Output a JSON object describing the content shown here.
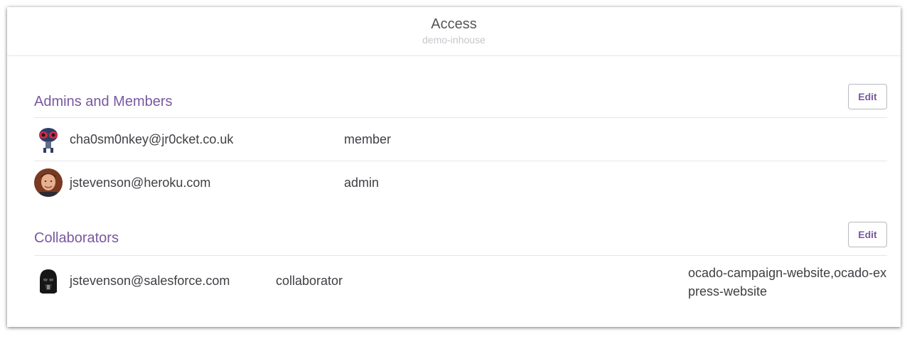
{
  "header": {
    "title": "Access",
    "subtitle": "demo-inhouse"
  },
  "admins_section": {
    "title": "Admins and Members",
    "edit_label": "Edit",
    "members": [
      {
        "email": "cha0sm0nkey@jr0cket.co.uk",
        "role": "member",
        "avatar": "alien-avatar"
      },
      {
        "email": "jstevenson@heroku.com",
        "role": "admin",
        "avatar": "person-avatar"
      }
    ]
  },
  "collaborators_section": {
    "title": "Collaborators",
    "edit_label": "Edit",
    "collaborators": [
      {
        "email": "jstevenson@salesforce.com",
        "role": "collaborator",
        "apps": "ocado-campaign-website,ocado-express-website",
        "avatar": "darth-vader-avatar"
      }
    ]
  },
  "colors": {
    "accent": "#79589f",
    "text": "#3f3f44",
    "divider": "#e6e6ea"
  }
}
